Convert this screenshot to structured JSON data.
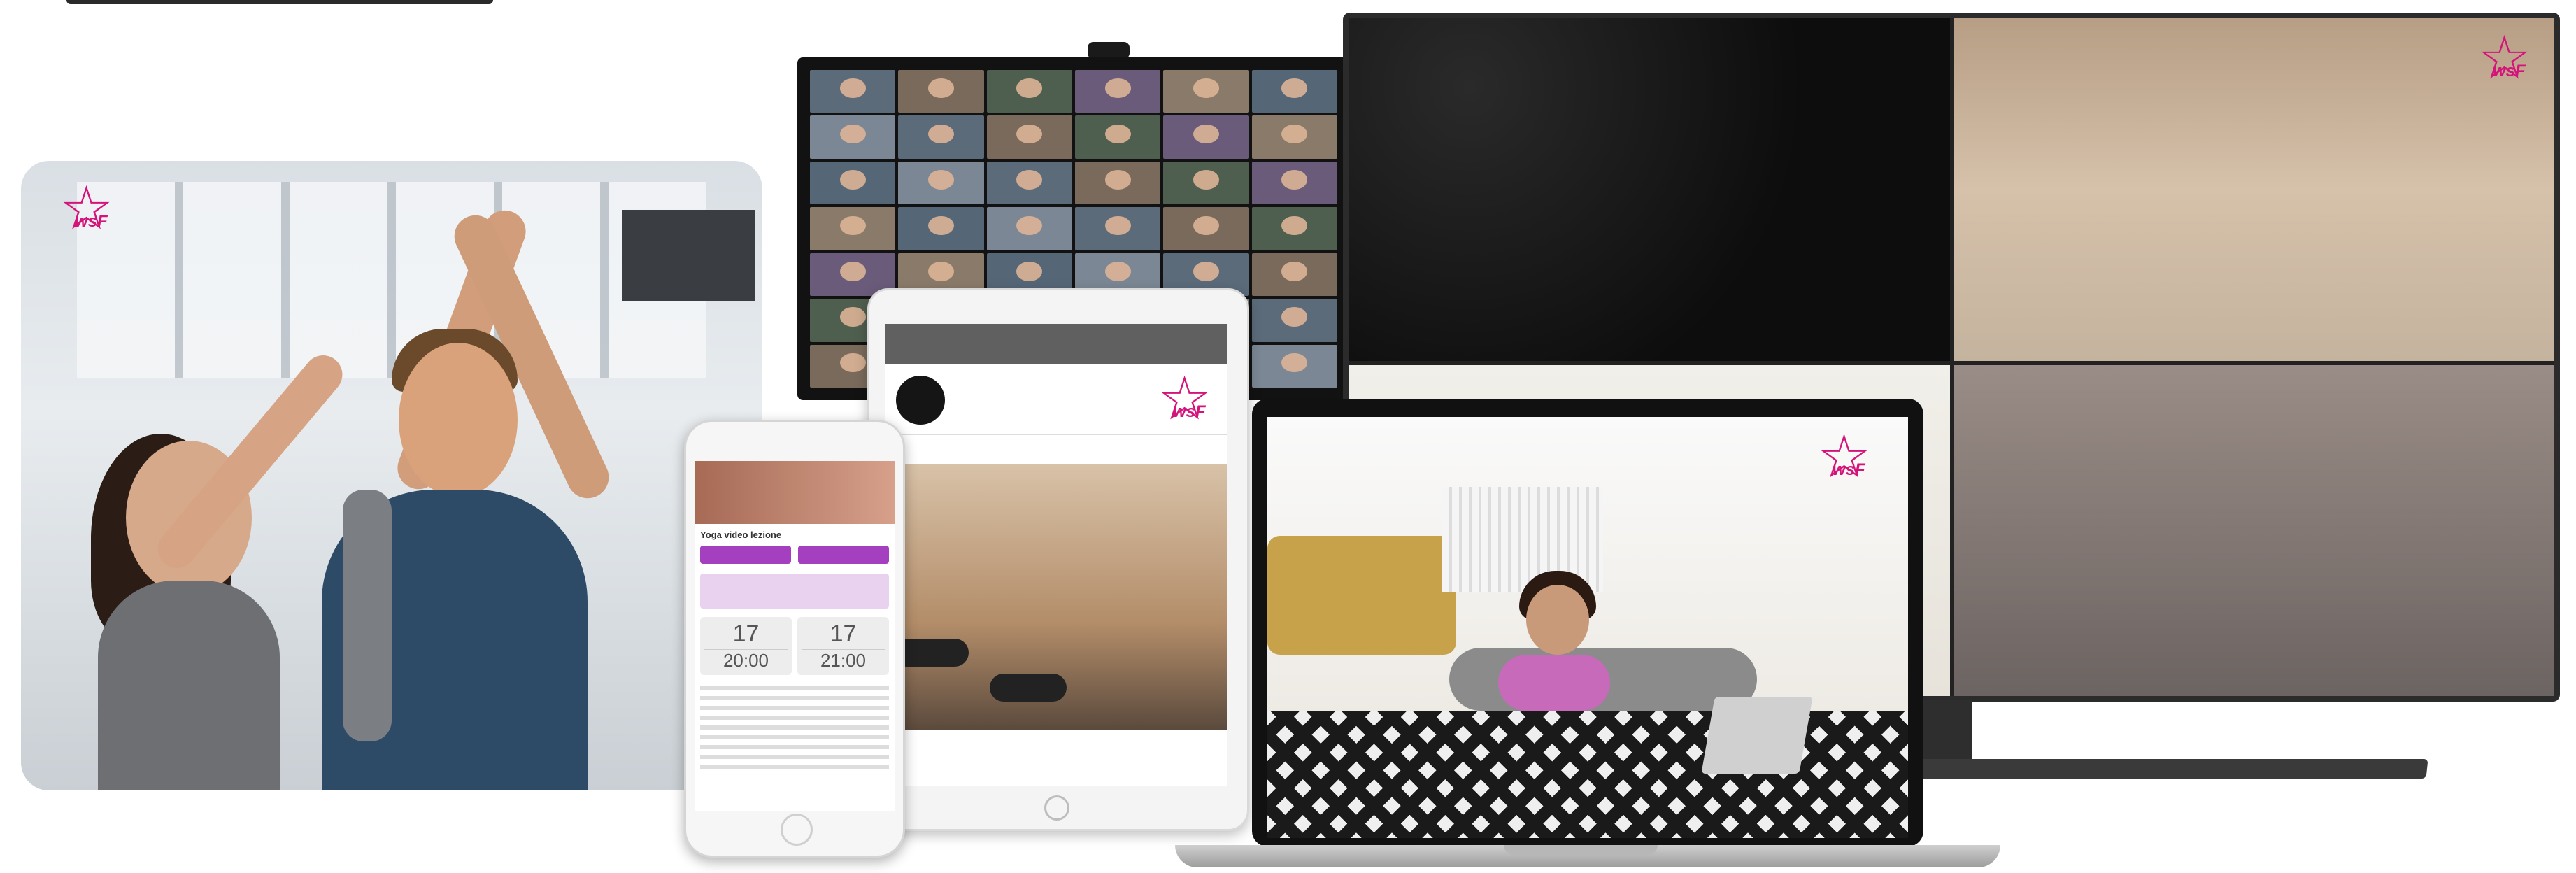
{
  "brand": {
    "logo_text": "wsF",
    "logo_color": "#d4147a"
  },
  "phone": {
    "class_title": "Yoga video lezione",
    "dates": [
      {
        "day": "17",
        "time": "20:00"
      },
      {
        "day": "17",
        "time": "21:00"
      }
    ]
  },
  "colors": {
    "accent_purple": "#a440c0",
    "tv_frame": "#2b2b2b",
    "laptop_frame": "#111111"
  },
  "icons": {
    "logo": "wsf-star-logo",
    "home_button": "home-button-circle"
  }
}
